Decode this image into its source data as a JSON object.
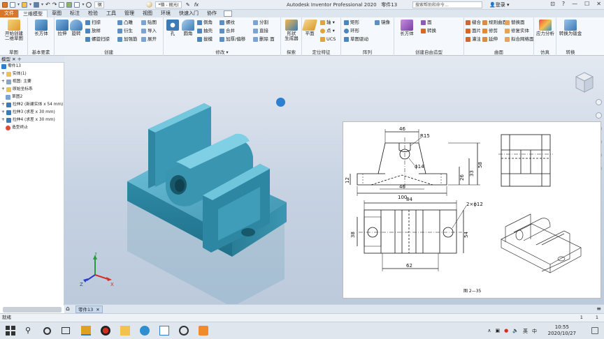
{
  "titlebar": {
    "material": "钢",
    "appearance": "*铬 - 抛光(",
    "app_title": "Autodesk Inventor Professional 2020",
    "doc_title": "零件13",
    "search_placeholder": "搜索帮助和命令...",
    "login": "登录",
    "fx": "fx"
  },
  "tabs": [
    "文件",
    "三维模型",
    "草图",
    "标注",
    "检验",
    "工具",
    "管理",
    "视图",
    "环境",
    "快速入门",
    "协作"
  ],
  "ribbon": {
    "sketch": {
      "label": "草图",
      "start_line1": "开始创建",
      "start_line2": "二维草图"
    },
    "primitives": {
      "label": "基本要素",
      "box": "长方体"
    },
    "create": {
      "label": "创建",
      "extrude": "拉伸",
      "revolve": "旋转",
      "sweep": "扫掠",
      "loft": "放样",
      "coil": "螺旋扫掠",
      "emboss": "凸雕",
      "derive": "衍生",
      "thicken": "加强筋",
      "decal": "贴图",
      "import": "导入",
      "unfold": "展开"
    },
    "modify": {
      "label": "修改 ▾",
      "hole": "孔",
      "fillet": "圆角",
      "chamfer": "倒角",
      "shell": "抽壳",
      "draft": "拔模",
      "thread": "螺纹",
      "combine": "合并",
      "thicken_offset": "加厚/偏移",
      "split": "分割",
      "direct": "直接",
      "delete_face": "删除 面"
    },
    "explore": {
      "label": "探索",
      "shape_gen_line1": "形状",
      "shape_gen_line2": "生成器"
    },
    "work": {
      "label": "定位特征",
      "plane": "平面",
      "axis": "轴 ▾",
      "point": "点 ▾",
      "ucs": "UCS"
    },
    "pattern": {
      "label": "阵列",
      "rect": "矩形",
      "circ": "环形",
      "sketch_driven": "草图驱动",
      "mirror": "镜像"
    },
    "freeform": {
      "label": "创建自由造型",
      "box": "长方体",
      "face": "面",
      "convert": "转换"
    },
    "surface": {
      "label": "曲面",
      "stitch": "缝合",
      "patch": "面片",
      "trim": "修剪",
      "sculpt": "灌注",
      "ruled": "规则曲面",
      "extend": "延伸",
      "repair": "修复实体",
      "fit_mesh": "拟合网格面",
      "replace": "替换面"
    },
    "simulation": {
      "label": "仿真",
      "stress": "应力分析"
    },
    "convert": {
      "label": "转换",
      "sheetmetal": "转换为钣金"
    }
  },
  "browser": {
    "header": "模型 ✕  ＋",
    "items": [
      "零件13",
      "实体(1)",
      "视图: 主要",
      "原始坐标系",
      "草图2",
      "拉伸2 (新建实体 x 54 mm)",
      "拉伸3 (求差 x 30 mm)",
      "拉伸4 (求差 x 30 mm)",
      "造型终止"
    ]
  },
  "drawing": {
    "dims": {
      "w46top": "46",
      "r15": "R15",
      "d14": "ϕ14",
      "h58": "58",
      "h33": "33",
      "h26": "26",
      "h12": "12",
      "w46mid": "46",
      "w100": "100",
      "w84": "84",
      "hole": "2×ϕ12",
      "h38": "38",
      "h54": "54",
      "w62": "62"
    },
    "caption": "图 2—35"
  },
  "doc_tab": {
    "name": "零件13",
    "close": "✕"
  },
  "status": {
    "text": "就绪",
    "n1": "1",
    "n2": "1"
  },
  "clock": {
    "time": "10:55",
    "date": "2020/10/27"
  },
  "tray": {
    "ime": "英",
    "lang": "中"
  },
  "colors": {
    "part": "#2f7f9a",
    "ribbon": "#f5f8fc",
    "file_tab": "#d8772a"
  }
}
